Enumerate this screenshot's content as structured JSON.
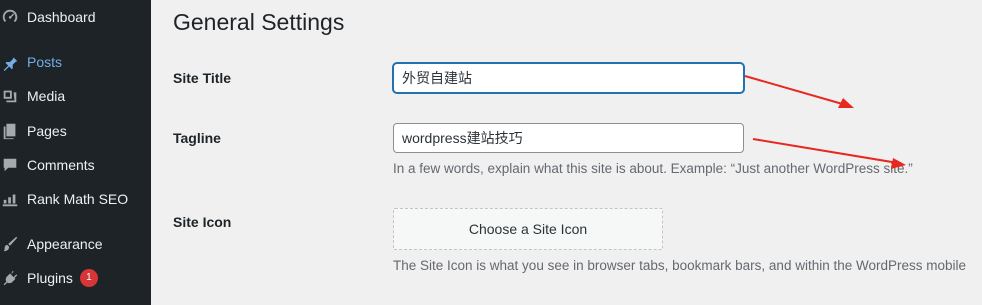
{
  "sidebar": {
    "items": [
      {
        "label": "Dashboard",
        "icon": "dashboard-icon"
      },
      {
        "label": "Posts",
        "icon": "pin-icon",
        "active": true
      },
      {
        "label": "Media",
        "icon": "media-icon"
      },
      {
        "label": "Pages",
        "icon": "pages-icon"
      },
      {
        "label": "Comments",
        "icon": "comment-icon"
      },
      {
        "label": "Rank Math SEO",
        "icon": "chart-icon"
      },
      {
        "label": "Appearance",
        "icon": "brush-icon"
      },
      {
        "label": "Plugins",
        "icon": "plugin-icon",
        "badge": "1"
      }
    ],
    "colors": {
      "background": "#1d2327",
      "active": "#72aee6",
      "badge": "#d63638"
    }
  },
  "main": {
    "title": "General Settings",
    "site_title": {
      "label": "Site Title",
      "value": "外贸自建站"
    },
    "tagline": {
      "label": "Tagline",
      "value": "wordpress建站技巧",
      "description": "In a few words, explain what this site is about. Example: “Just another WordPress site.”"
    },
    "site_icon": {
      "label": "Site Icon",
      "button": "Choose a Site Icon",
      "description": "The Site Icon is what you see in browser tabs, bookmark bars, and within the WordPress mobile"
    }
  },
  "annotation": {
    "arrow_color": "#e8271e"
  }
}
